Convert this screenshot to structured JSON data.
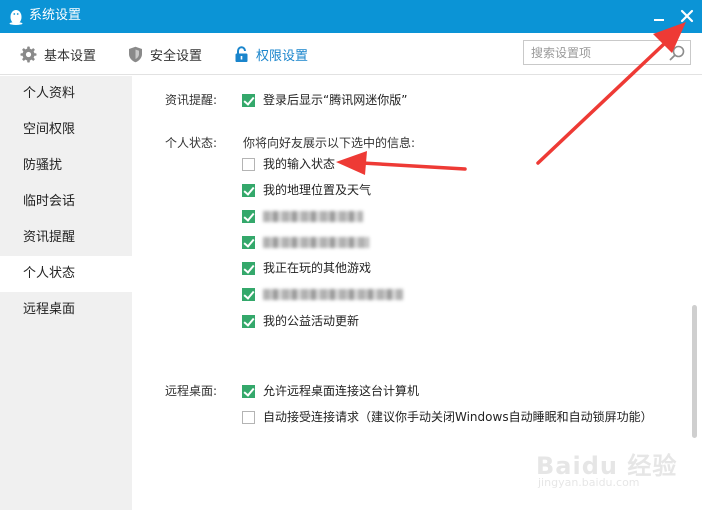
{
  "window": {
    "title": "系统设置",
    "title_icon": "qq-penguin-icon",
    "accent": "#0b94d6"
  },
  "toolbar": {
    "basic": {
      "label": "基本设置",
      "icon": "gear-icon"
    },
    "security": {
      "label": "安全设置",
      "icon": "shield-icon"
    },
    "permission": {
      "label": "权限设置",
      "icon": "lock-icon"
    }
  },
  "search": {
    "placeholder": "搜索设置项",
    "value": ""
  },
  "sidebar": {
    "items": [
      {
        "label": "个人资料"
      },
      {
        "label": "空间权限"
      },
      {
        "label": "防骚扰"
      },
      {
        "label": "临时会话"
      },
      {
        "label": "资讯提醒"
      },
      {
        "label": "个人状态",
        "selected": true
      },
      {
        "label": "远程桌面"
      }
    ]
  },
  "content": {
    "news": {
      "label": "资讯提醒:",
      "option": {
        "label": "登录后显示“腾讯网迷你版”",
        "checked": true
      }
    },
    "status": {
      "label": "个人状态:",
      "hint": "你将向好友展示以下选中的信息:",
      "options": [
        {
          "label": "我的输入状态",
          "checked": false
        },
        {
          "label": "我的地理位置及天气",
          "checked": true
        },
        {
          "label": "",
          "checked": true
        },
        {
          "label": "",
          "checked": true
        },
        {
          "label": "我正在玩的其他游戏",
          "checked": true
        },
        {
          "label": "",
          "checked": true
        },
        {
          "label": "我的公益活动更新",
          "checked": true
        }
      ]
    },
    "remote": {
      "label": "远程桌面:",
      "options": [
        {
          "label": "允许远程桌面连接这台计算机",
          "checked": true
        },
        {
          "label": "自动接受连接请求（建议你手动关闭Windows自动睡眠和自动锁屏功能）",
          "checked": false
        }
      ]
    }
  },
  "colors": {
    "check_green": "#34a86b",
    "active_tab": "#1a85cc",
    "annotation_red": "#ee3a35"
  },
  "watermark": {
    "brand": "Baidu 经验",
    "url": "jingyan.baidu.com"
  }
}
